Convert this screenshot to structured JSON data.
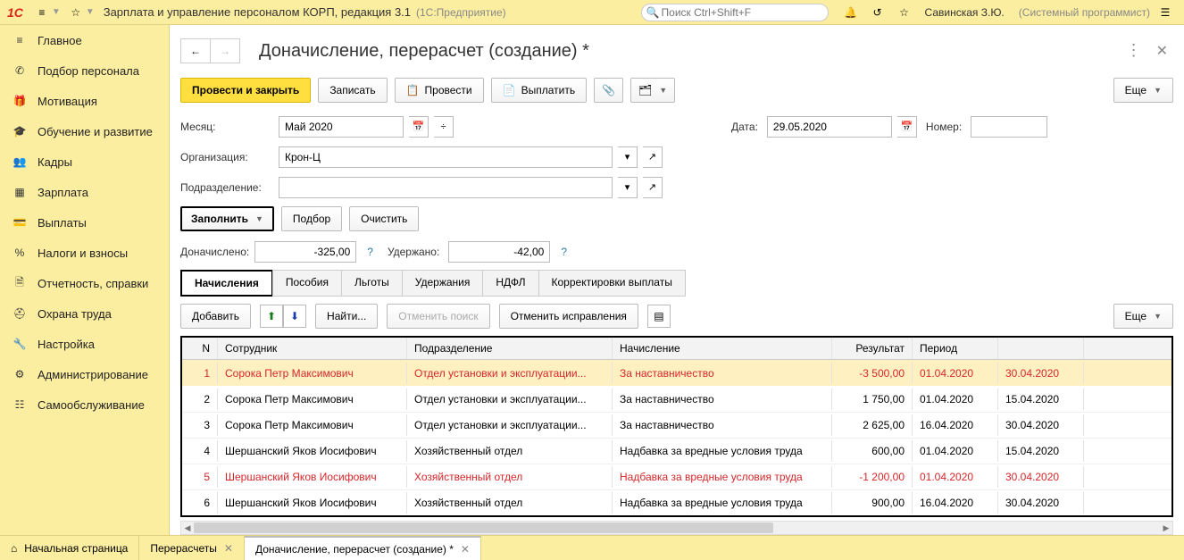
{
  "app": {
    "title": "Зарплата и управление персоналом КОРП, редакция 3.1",
    "platform": "(1С:Предприятие)",
    "search_placeholder": "Поиск Ctrl+Shift+F",
    "username": "Савинская З.Ю.",
    "userrole": "(Системный программист)"
  },
  "sidebar": {
    "items": [
      {
        "label": "Главное"
      },
      {
        "label": "Подбор персонала"
      },
      {
        "label": "Мотивация"
      },
      {
        "label": "Обучение и развитие"
      },
      {
        "label": "Кадры"
      },
      {
        "label": "Зарплата"
      },
      {
        "label": "Выплаты"
      },
      {
        "label": "Налоги и взносы"
      },
      {
        "label": "Отчетность, справки"
      },
      {
        "label": "Охрана труда"
      },
      {
        "label": "Настройка"
      },
      {
        "label": "Администрирование"
      },
      {
        "label": "Самообслуживание"
      }
    ]
  },
  "doc": {
    "title": "Доначисление, перерасчет (создание) *",
    "toolbar": {
      "post_close": "Провести и закрыть",
      "save": "Записать",
      "post": "Провести",
      "pay": "Выплатить",
      "more": "Еще"
    },
    "fields": {
      "month_lbl": "Месяц:",
      "month": "Май 2020",
      "date_lbl": "Дата:",
      "date": "29.05.2020",
      "number_lbl": "Номер:",
      "number": "",
      "org_lbl": "Организация:",
      "org": "Крон-Ц",
      "dep_lbl": "Подразделение:",
      "dep": ""
    },
    "fill_row": {
      "fill": "Заполнить",
      "pick": "Подбор",
      "clear": "Очистить"
    },
    "totals": {
      "accrued_lbl": "Доначислено:",
      "accrued": "-325,00",
      "withheld_lbl": "Удержано:",
      "withheld": "-42,00"
    },
    "tabs": {
      "t0": "Начисления",
      "t1": "Пособия",
      "t2": "Льготы",
      "t3": "Удержания",
      "t4": "НДФЛ",
      "t5": "Корректировки выплаты"
    },
    "grid_toolbar": {
      "add": "Добавить",
      "find": "Найти...",
      "cancel_search": "Отменить поиск",
      "cancel_fix": "Отменить исправления",
      "more": "Еще"
    },
    "grid": {
      "headers": {
        "n": "N",
        "emp": "Сотрудник",
        "dep": "Подразделение",
        "acc": "Начисление",
        "res": "Результат",
        "period": "Период"
      },
      "rows": [
        {
          "n": "1",
          "emp": "Сорока Петр Максимович",
          "dep": "Отдел установки и эксплуатации...",
          "acc": "За наставничество",
          "res": "-3 500,00",
          "p1": "01.04.2020",
          "p2": "30.04.2020",
          "red": true,
          "sel": true
        },
        {
          "n": "2",
          "emp": "Сорока Петр Максимович",
          "dep": "Отдел установки и эксплуатации...",
          "acc": "За наставничество",
          "res": "1 750,00",
          "p1": "01.04.2020",
          "p2": "15.04.2020"
        },
        {
          "n": "3",
          "emp": "Сорока Петр Максимович",
          "dep": "Отдел установки и эксплуатации...",
          "acc": "За наставничество",
          "res": "2 625,00",
          "p1": "16.04.2020",
          "p2": "30.04.2020"
        },
        {
          "n": "4",
          "emp": "Шершанский Яков Иосифович",
          "dep": "Хозяйственный отдел",
          "acc": "Надбавка за вредные условия труда",
          "res": "600,00",
          "p1": "01.04.2020",
          "p2": "15.04.2020"
        },
        {
          "n": "5",
          "emp": "Шершанский Яков Иосифович",
          "dep": "Хозяйственный отдел",
          "acc": "Надбавка за вредные условия труда",
          "res": "-1 200,00",
          "p1": "01.04.2020",
          "p2": "30.04.2020",
          "red": true
        },
        {
          "n": "6",
          "emp": "Шершанский Яков Иосифович",
          "dep": "Хозяйственный отдел",
          "acc": "Надбавка за вредные условия труда",
          "res": "900,00",
          "p1": "16.04.2020",
          "p2": "30.04.2020"
        }
      ]
    }
  },
  "bottom_tabs": {
    "home": "Начальная страница",
    "t0": "Перерасчеты",
    "t1": "Доначисление, перерасчет (создание) *"
  }
}
